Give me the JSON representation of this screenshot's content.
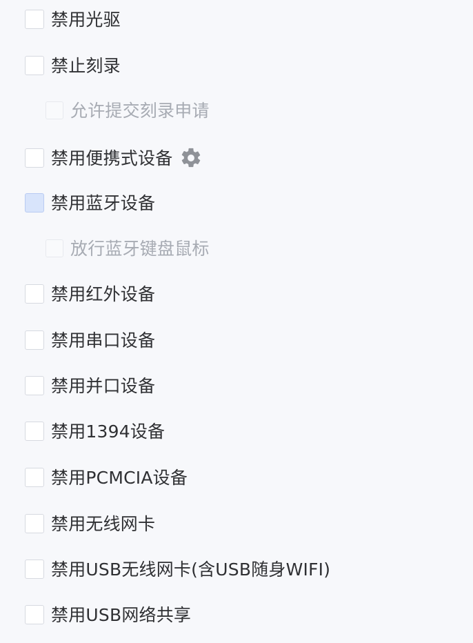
{
  "options": [
    {
      "key": "disable_cd",
      "label": "禁用光驱",
      "checked": false,
      "disabled": false
    },
    {
      "key": "disable_burn",
      "label": "禁止刻录",
      "checked": false,
      "disabled": false
    },
    {
      "key": "allow_burn_request",
      "label": "允许提交刻录申请",
      "checked": false,
      "disabled": true
    },
    {
      "key": "disable_portable",
      "label": "禁用便携式设备",
      "checked": false,
      "disabled": false,
      "icon": "gear-icon"
    },
    {
      "key": "disable_bluetooth",
      "label": "禁用蓝牙设备",
      "checked": false,
      "disabled": false
    },
    {
      "key": "allow_bt_keyboard_mouse",
      "label": "放行蓝牙键盘鼠标",
      "checked": false,
      "disabled": true
    },
    {
      "key": "disable_infrared",
      "label": "禁用红外设备",
      "checked": false,
      "disabled": false
    },
    {
      "key": "disable_serial",
      "label": "禁用串口设备",
      "checked": false,
      "disabled": false
    },
    {
      "key": "disable_parallel",
      "label": "禁用并口设备",
      "checked": false,
      "disabled": false
    },
    {
      "key": "disable_1394",
      "label": "禁用1394设备",
      "checked": false,
      "disabled": false
    },
    {
      "key": "disable_pcmcia",
      "label": "禁用PCMCIA设备",
      "checked": false,
      "disabled": false
    },
    {
      "key": "disable_wireless_card",
      "label": "禁用无线网卡",
      "checked": false,
      "disabled": false
    },
    {
      "key": "disable_usb_wireless_card",
      "label": "禁用USB无线网卡(含USB随身WIFI)",
      "checked": false,
      "disabled": false
    },
    {
      "key": "disable_usb_tethering",
      "label": "禁用USB网络共享",
      "checked": false,
      "disabled": false
    }
  ],
  "colors": {
    "background": "#f7f8fb",
    "text": "#2f3033",
    "text_disabled": "#a7abb3",
    "checkbox_border": "#d6d9e0",
    "checkbox_hover": "#d8e4fb",
    "gear": "#8f9298"
  }
}
